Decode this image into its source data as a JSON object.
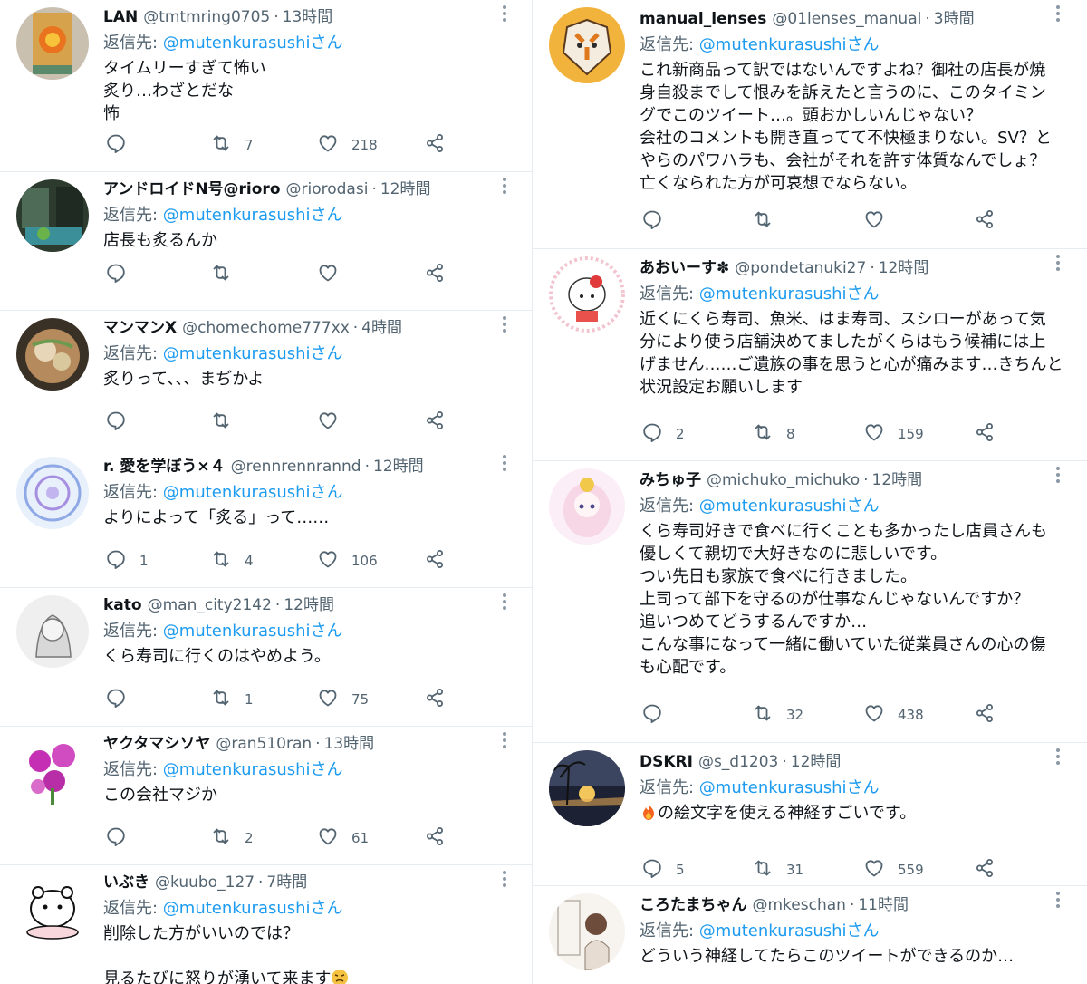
{
  "reply_prefix": "返信先: ",
  "left": [
    {
      "name": "LAN",
      "handle": "@tmtmring0705",
      "time": "13時間",
      "reply_to": "@mutenkurasushiさん",
      "text": "タイムリーすぎて怖い\n炙り…わざとだな\n怖",
      "replies": "",
      "retweets": "7",
      "likes": "218"
    },
    {
      "name": "アンドロイドN号@rioro",
      "handle": "@riorodasi",
      "time": "12時間",
      "reply_to": "@mutenkurasushiさん",
      "text": "店長も炙るんか",
      "replies": "",
      "retweets": "",
      "likes": ""
    },
    {
      "name": "マンマンX",
      "handle": "@chomechome777xx",
      "time": "4時間",
      "reply_to": "@mutenkurasushiさん",
      "text": "炙りって、、、まぢかよ",
      "replies": "",
      "retweets": "",
      "likes": ""
    },
    {
      "name": "r. 愛を学ぼう×４",
      "handle": "@rennrennrannd",
      "time": "12時間",
      "reply_to": "@mutenkurasushiさん",
      "text": "よりによって「炙る」って……",
      "replies": "1",
      "retweets": "4",
      "likes": "106"
    },
    {
      "name": "kato",
      "handle": "@man_city2142",
      "time": "12時間",
      "reply_to": "@mutenkurasushiさん",
      "text": "くら寿司に行くのはやめよう。",
      "replies": "",
      "retweets": "1",
      "likes": "75"
    },
    {
      "name": "ヤクタマシソヤ",
      "handle": "@ran510ran",
      "time": "13時間",
      "reply_to": "@mutenkurasushiさん",
      "text": "この会社マジか",
      "replies": "",
      "retweets": "2",
      "likes": "61"
    },
    {
      "name": "いぶき",
      "handle": "@kuubo_127",
      "time": "7時間",
      "reply_to": "@mutenkurasushiさん",
      "text": "削除した方がいいのでは？\n\n見るたびに怒りが湧いて来ます",
      "replies": "",
      "retweets": "",
      "likes": ""
    }
  ],
  "right": [
    {
      "name": "manual_lenses",
      "handle": "@01lenses_manual",
      "time": "3時間",
      "reply_to": "@mutenkurasushiさん",
      "text": "これ新商品って訳ではないんですよね？御社の店長が焼\n身自殺までして恨みを訴えたと言うのに、このタイミン\nグでこのツイート…。頭おかしいんじゃない？\n会社のコメントも開き直ってて不快極まりない。SV？と\nやらのパワハラも、会社がそれを許す体質なんでしょ？\n亡くなられた方が可哀想でならない。",
      "replies": "",
      "retweets": "",
      "likes": ""
    },
    {
      "name": "あおいーす✽",
      "handle": "@pondetanuki27",
      "time": "12時間",
      "reply_to": "@mutenkurasushiさん",
      "text": "近くにくら寿司、魚米、はま寿司、スシローがあって気\n分により使う店舗決めてましたがくらはもう候補には上\nげません……ご遺族の事を思うと心が痛みます…きちんと\n状況設定お願いします",
      "replies": "2",
      "retweets": "8",
      "likes": "159"
    },
    {
      "name": "みちゅ子",
      "handle": "@michuko_michuko",
      "time": "12時間",
      "reply_to": "@mutenkurasushiさん",
      "text": "くら寿司好きで食べに行くことも多かったし店員さんも\n優しくて親切で大好きなのに悲しいです。\nつい先日も家族で食べに行きました。\n上司って部下を守るのが仕事なんじゃないんですか？\n追いつめてどうするんですか…\nこんな事になって一緒に働いていた従業員さんの心の傷\nも心配です。",
      "replies": "",
      "retweets": "32",
      "likes": "438"
    },
    {
      "name": "DSKRI",
      "handle": "@s_d1203",
      "time": "12時間",
      "reply_to": "@mutenkurasushiさん",
      "text": "の絵文字を使える神経すごいです。",
      "replies": "5",
      "retweets": "31",
      "likes": "559"
    },
    {
      "name": "ころたまちゃん",
      "handle": "@mkeschan",
      "time": "11時間",
      "reply_to": "@mutenkurasushiさん",
      "text": "どういう神経してたらこのツイートができるのか…",
      "replies": "",
      "retweets": "",
      "likes": ""
    }
  ],
  "icons": {
    "reply": "speech-bubble-icon",
    "retweet": "retweet-arrows-icon",
    "like": "heart-icon",
    "share": "share-nodes-icon",
    "more": "vertical-ellipsis-icon",
    "fire": "fire-emoji-icon",
    "angry": "angry-face-emoji-icon"
  },
  "colors": {
    "text": "#0f1419",
    "secondary": "#536471",
    "mention": "#1d9bf0",
    "divider": "#e6ecf0"
  }
}
